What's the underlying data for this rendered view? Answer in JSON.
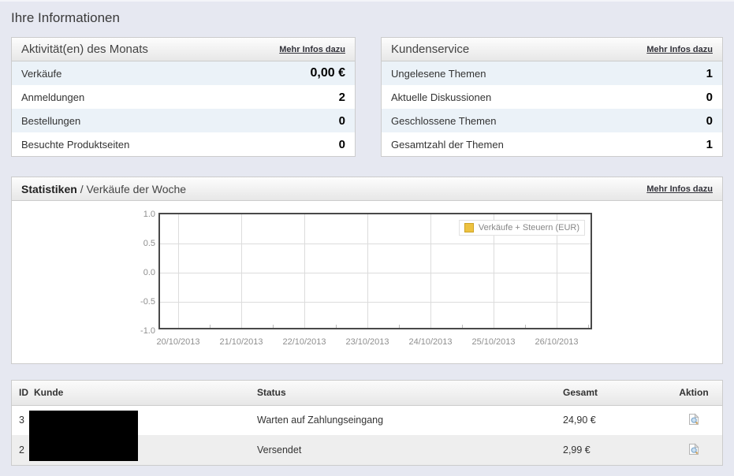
{
  "page": {
    "title": "Ihre Informationen"
  },
  "colors": {
    "page_background": "#E6E8F1",
    "panel_border": "#CCCCCC",
    "row_stripe_blue": "#EBF2F8",
    "table_stripe_gray": "#EEEEEE",
    "chart_series_yellow": "#EDC240",
    "plot_border": "#494949",
    "gridline": "#DCDCDC"
  },
  "activity_panel": {
    "title": "Aktivität(en) des Monats",
    "more_link": "Mehr Infos dazu",
    "rows": [
      {
        "label": "Verkäufe",
        "value": "0,00 €"
      },
      {
        "label": "Anmeldungen",
        "value": "2"
      },
      {
        "label": "Bestellungen",
        "value": "0"
      },
      {
        "label": "Besuchte Produktseiten",
        "value": "0"
      }
    ]
  },
  "service_panel": {
    "title": "Kundenservice",
    "more_link": "Mehr Infos dazu",
    "rows": [
      {
        "label": "Ungelesene Themen",
        "value": "1"
      },
      {
        "label": "Aktuelle Diskussionen",
        "value": "0"
      },
      {
        "label": "Geschlossene Themen",
        "value": "0"
      },
      {
        "label": "Gesamtzahl der Themen",
        "value": "1"
      }
    ]
  },
  "stats_panel": {
    "title_bold": "Statistiken",
    "title_rest": "/ Verkäufe der Woche",
    "more_link": "Mehr Infos dazu"
  },
  "chart_data": {
    "type": "line",
    "title": "Verkäufe der Woche",
    "categories": [
      "20/10/2013",
      "21/10/2013",
      "22/10/2013",
      "23/10/2013",
      "24/10/2013",
      "25/10/2013",
      "26/10/2013"
    ],
    "series": [
      {
        "name": "Verkäufe + Steuern (EUR)",
        "color": "#EDC240",
        "values": []
      }
    ],
    "ylim": [
      -1.0,
      1.0
    ],
    "y_ticks": [
      "1.0",
      "0.5",
      "0.0",
      "-0.5",
      "-1.0"
    ],
    "grid": true,
    "legend_position": "top-right"
  },
  "orders_table": {
    "headers": {
      "id": "ID",
      "kunde": "Kunde",
      "status": "Status",
      "gesamt": "Gesamt",
      "aktion": "Aktion"
    },
    "rows": [
      {
        "id": "3",
        "customer_redacted": true,
        "status": "Warten auf Zahlungseingang",
        "total": "24,90 €",
        "action": "view-details"
      },
      {
        "id": "2",
        "customer_redacted": true,
        "status": "Versendet",
        "total": "2,99 €",
        "action": "view-details"
      }
    ]
  }
}
